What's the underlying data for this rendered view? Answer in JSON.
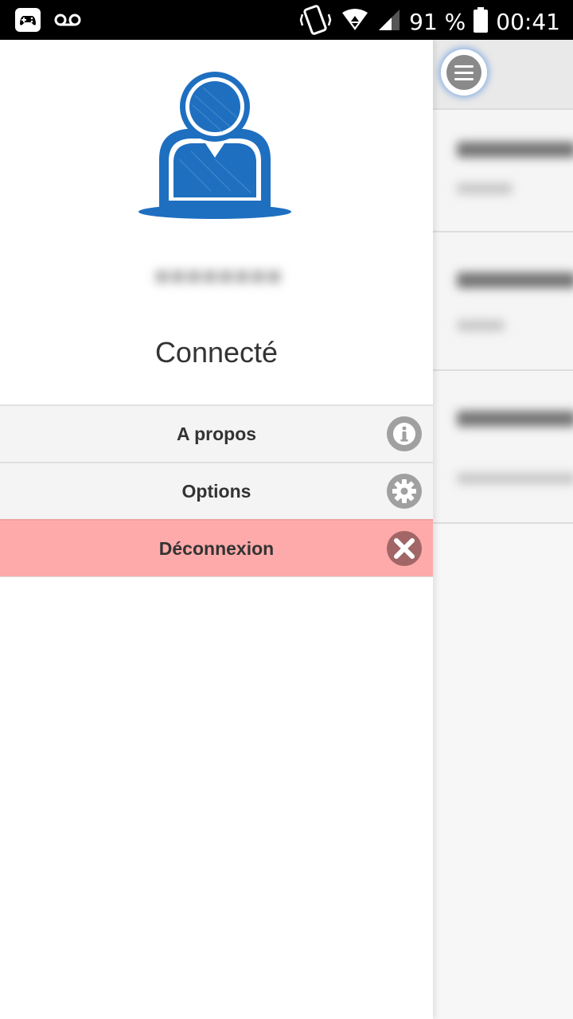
{
  "status_bar": {
    "battery_percent": "91 %",
    "time": "00:41",
    "icons": [
      "game-controller-icon",
      "voicemail-icon",
      "vibrate-icon",
      "wifi-icon",
      "signal-icon",
      "battery-icon"
    ]
  },
  "drawer": {
    "connection_status": "Connecté",
    "menu": [
      {
        "label": "A propos",
        "icon": "info-icon"
      },
      {
        "label": "Options",
        "icon": "gear-icon"
      },
      {
        "label": "Déconnexion",
        "icon": "close-icon"
      }
    ]
  },
  "colors": {
    "accent_blue": "#1e6fc0",
    "danger_bg": "#ffaaaa",
    "icon_gray": "#a0a0a0"
  }
}
